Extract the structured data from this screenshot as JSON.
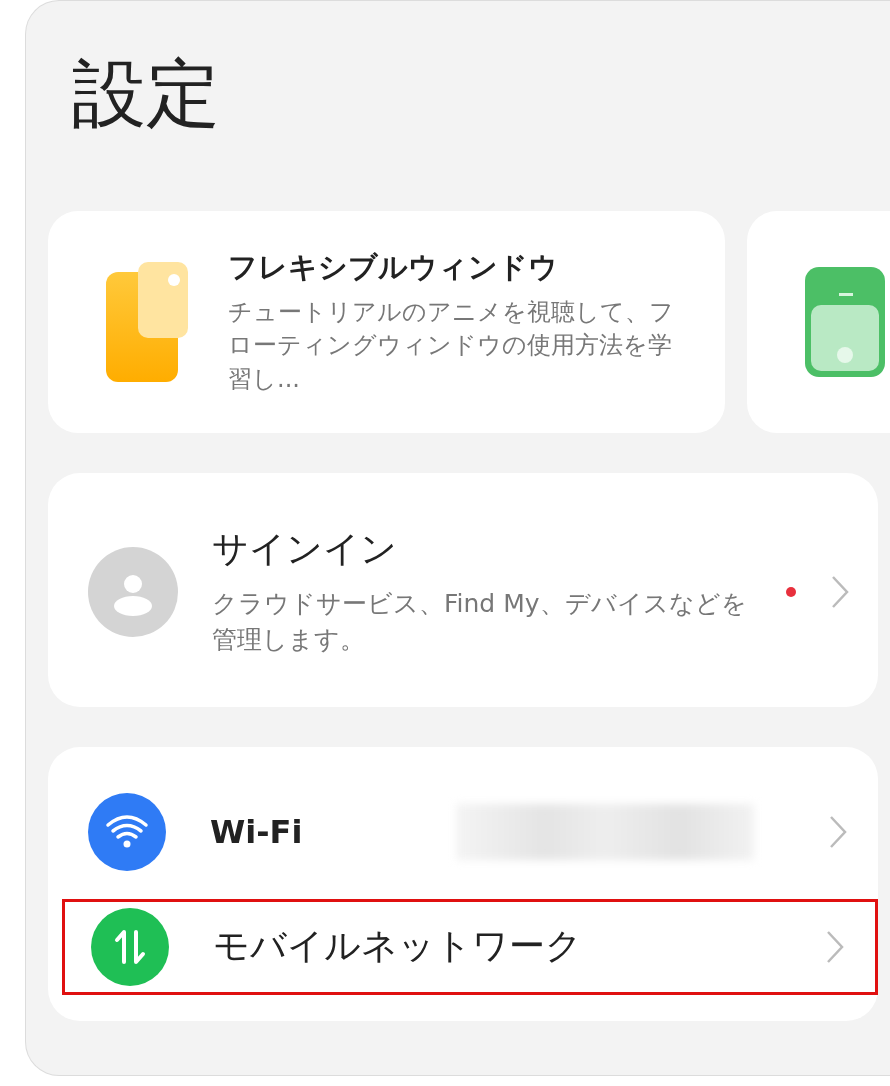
{
  "title": "設定",
  "feature_cards": [
    {
      "kind": "flexible-window",
      "title": "フレキシブルウィンドウ",
      "description": "チュートリアルのアニメを視聴して、フローティングウィンドウの使用方法を学習し..."
    },
    {
      "kind": "phone-window"
    }
  ],
  "account": {
    "title": "サインイン",
    "description": "クラウドサービス、Find My、デバイスなどを管理します。",
    "notification_dot": true
  },
  "network": [
    {
      "kind": "wifi",
      "label": "Wi-Fi",
      "value_hidden": true,
      "highlighted": false
    },
    {
      "kind": "mobile",
      "label": "モバイルネットワーク",
      "value_hidden": false,
      "highlighted": true
    }
  ]
}
